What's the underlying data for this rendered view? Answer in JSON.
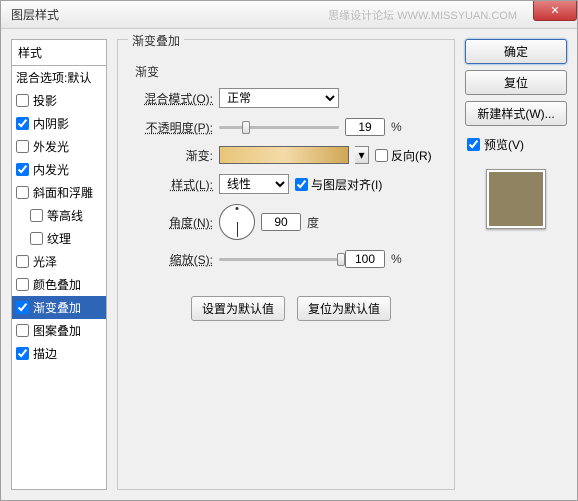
{
  "window": {
    "title": "图层样式",
    "watermark": "思缘设计论坛  WWW.MISSYUAN.COM"
  },
  "left": {
    "header": "样式",
    "blend_header": "混合选项:默认",
    "items": [
      {
        "label": "投影",
        "checked": false
      },
      {
        "label": "内阴影",
        "checked": true
      },
      {
        "label": "外发光",
        "checked": false
      },
      {
        "label": "内发光",
        "checked": true
      },
      {
        "label": "斜面和浮雕",
        "checked": false
      },
      {
        "label": "等高线",
        "checked": false,
        "indent": true
      },
      {
        "label": "纹理",
        "checked": false,
        "indent": true
      },
      {
        "label": "光泽",
        "checked": false
      },
      {
        "label": "颜色叠加",
        "checked": false
      },
      {
        "label": "渐变叠加",
        "checked": true,
        "active": true
      },
      {
        "label": "图案叠加",
        "checked": false
      },
      {
        "label": "描边",
        "checked": true
      }
    ]
  },
  "center": {
    "group_title": "渐变叠加",
    "subgroup": "渐变",
    "blend_label": "混合模式(O):",
    "blend_value": "正常",
    "opacity_label": "不透明度(P):",
    "opacity_value": "19",
    "pct": "%",
    "gradient_label": "渐变:",
    "reverse_label": "反向(R)",
    "style_label": "样式(L):",
    "style_value": "线性",
    "align_label": "与图层对齐(I)",
    "angle_label": "角度(N):",
    "angle_value": "90",
    "angle_unit": "度",
    "scale_label": "缩放(S):",
    "scale_value": "100",
    "default_btn": "设置为默认值",
    "reset_btn": "复位为默认值"
  },
  "right": {
    "ok": "确定",
    "cancel": "复位",
    "new_style": "新建样式(W)...",
    "preview": "预览(V)"
  }
}
